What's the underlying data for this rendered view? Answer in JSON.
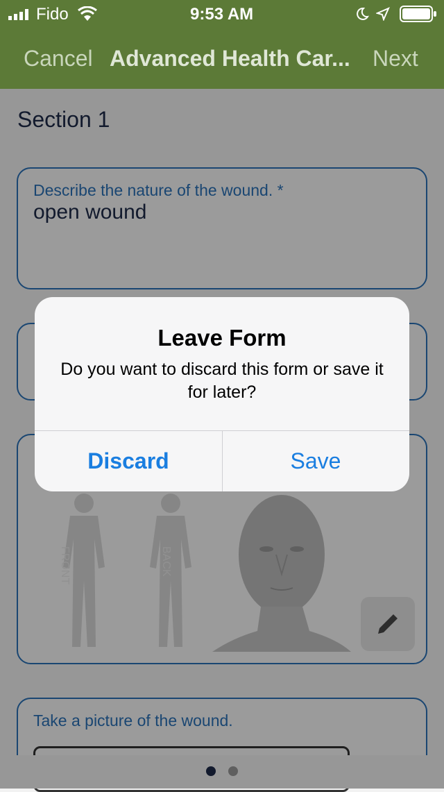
{
  "status_bar": {
    "carrier": "Fido",
    "time": "9:53 AM"
  },
  "nav": {
    "cancel_label": "Cancel",
    "title": "Advanced Health Car...",
    "next_label": "Next"
  },
  "form": {
    "section_title": "Section 1",
    "wound_description": {
      "label": "Describe the nature of the wound. *",
      "value": "open wound"
    },
    "body_map": {
      "front_label": "FRONT",
      "back_label": "BACK"
    },
    "picture": {
      "label": "Take a picture of the wound."
    }
  },
  "pager": {
    "page_count": 2,
    "current_page": 1
  },
  "dialog": {
    "title": "Leave Form",
    "message": "Do you want to discard this form or save it for later?",
    "discard_label": "Discard",
    "save_label": "Save"
  },
  "colors": {
    "nav_green": "#5c7a37",
    "accent_blue": "#2a72b8",
    "button_blue": "#1a7ee0"
  }
}
